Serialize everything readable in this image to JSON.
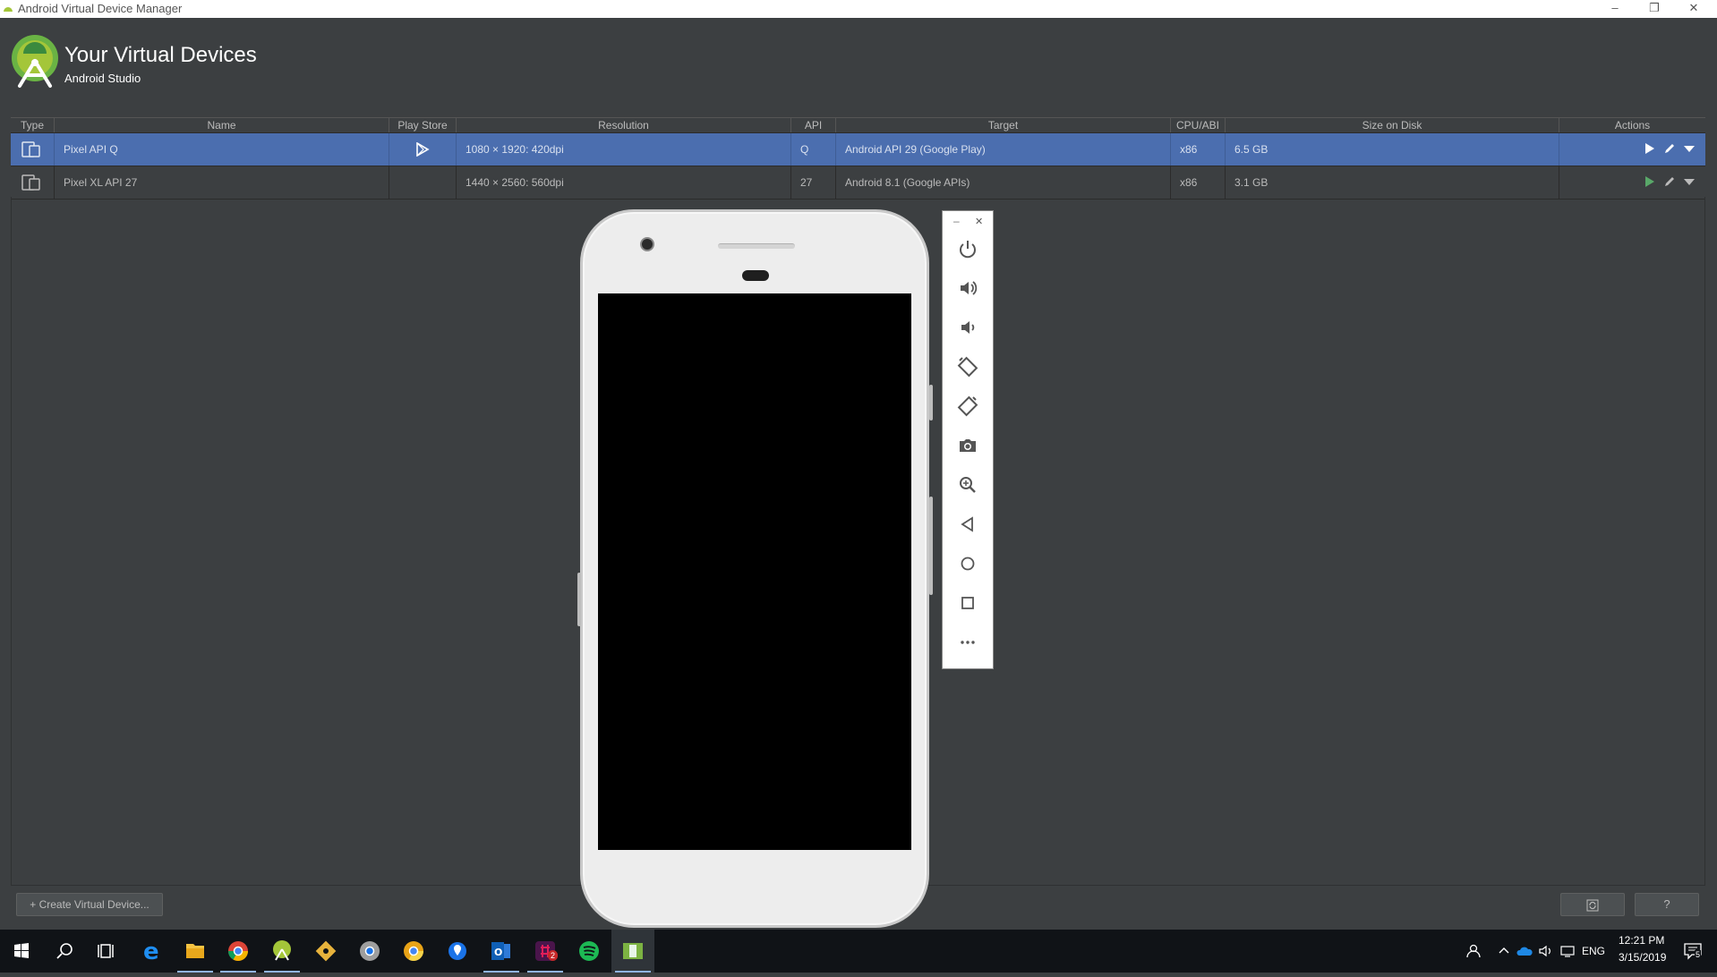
{
  "window": {
    "title": "Android Virtual Device Manager",
    "controls": {
      "minimize": "–",
      "restore": "❐",
      "close": "✕"
    }
  },
  "header": {
    "title": "Your Virtual Devices",
    "subtitle": "Android Studio"
  },
  "table": {
    "columns": [
      "Type",
      "Name",
      "Play Store",
      "Resolution",
      "API",
      "Target",
      "CPU/ABI",
      "Size on Disk",
      "Actions"
    ],
    "rows": [
      {
        "name": "Pixel API Q",
        "resolution": "1080 × 1920: 420dpi",
        "api": "Q",
        "target": "Android API 29 (Google Play)",
        "cpu": "x86",
        "size": "6.5 GB",
        "play_store": true,
        "selected": true
      },
      {
        "name": "Pixel XL API 27",
        "resolution": "1440 × 2560: 560dpi",
        "api": "27",
        "target": "Android 8.1 (Google APIs)",
        "cpu": "x86",
        "size": "3.1 GB",
        "play_store": false,
        "selected": false
      }
    ]
  },
  "footer": {
    "create_button": "+ Create Virtual Device...",
    "refresh_icon": "refresh-icon",
    "help_label": "?"
  },
  "emulator_toolbar": {
    "minimize": "–",
    "close": "✕",
    "buttons": [
      "power-icon",
      "volume-up-icon",
      "volume-down-icon",
      "rotate-left-icon",
      "rotate-right-icon",
      "camera-icon",
      "zoom-icon",
      "back-icon",
      "home-icon",
      "overview-icon",
      "more-icon"
    ]
  },
  "taskbar": {
    "language": "ENG",
    "time": "12:21 PM",
    "date": "3/15/2019",
    "notification_count": "5",
    "apps": [
      "start-icon",
      "search-icon",
      "task-view-icon",
      "edge-icon",
      "file-explorer-icon",
      "chrome-icon",
      "android-studio-icon",
      "git-icon",
      "chrome-dev-icon",
      "chrome-canary-icon",
      "maps-icon",
      "outlook-icon",
      "slack-icon",
      "spotify-icon",
      "emulator-icon"
    ],
    "slack_badge": "2"
  },
  "colors": {
    "background": "#3c3f41",
    "selection": "#4b6eaf",
    "android_green": "#a4c639",
    "run_green": "#59a869"
  }
}
